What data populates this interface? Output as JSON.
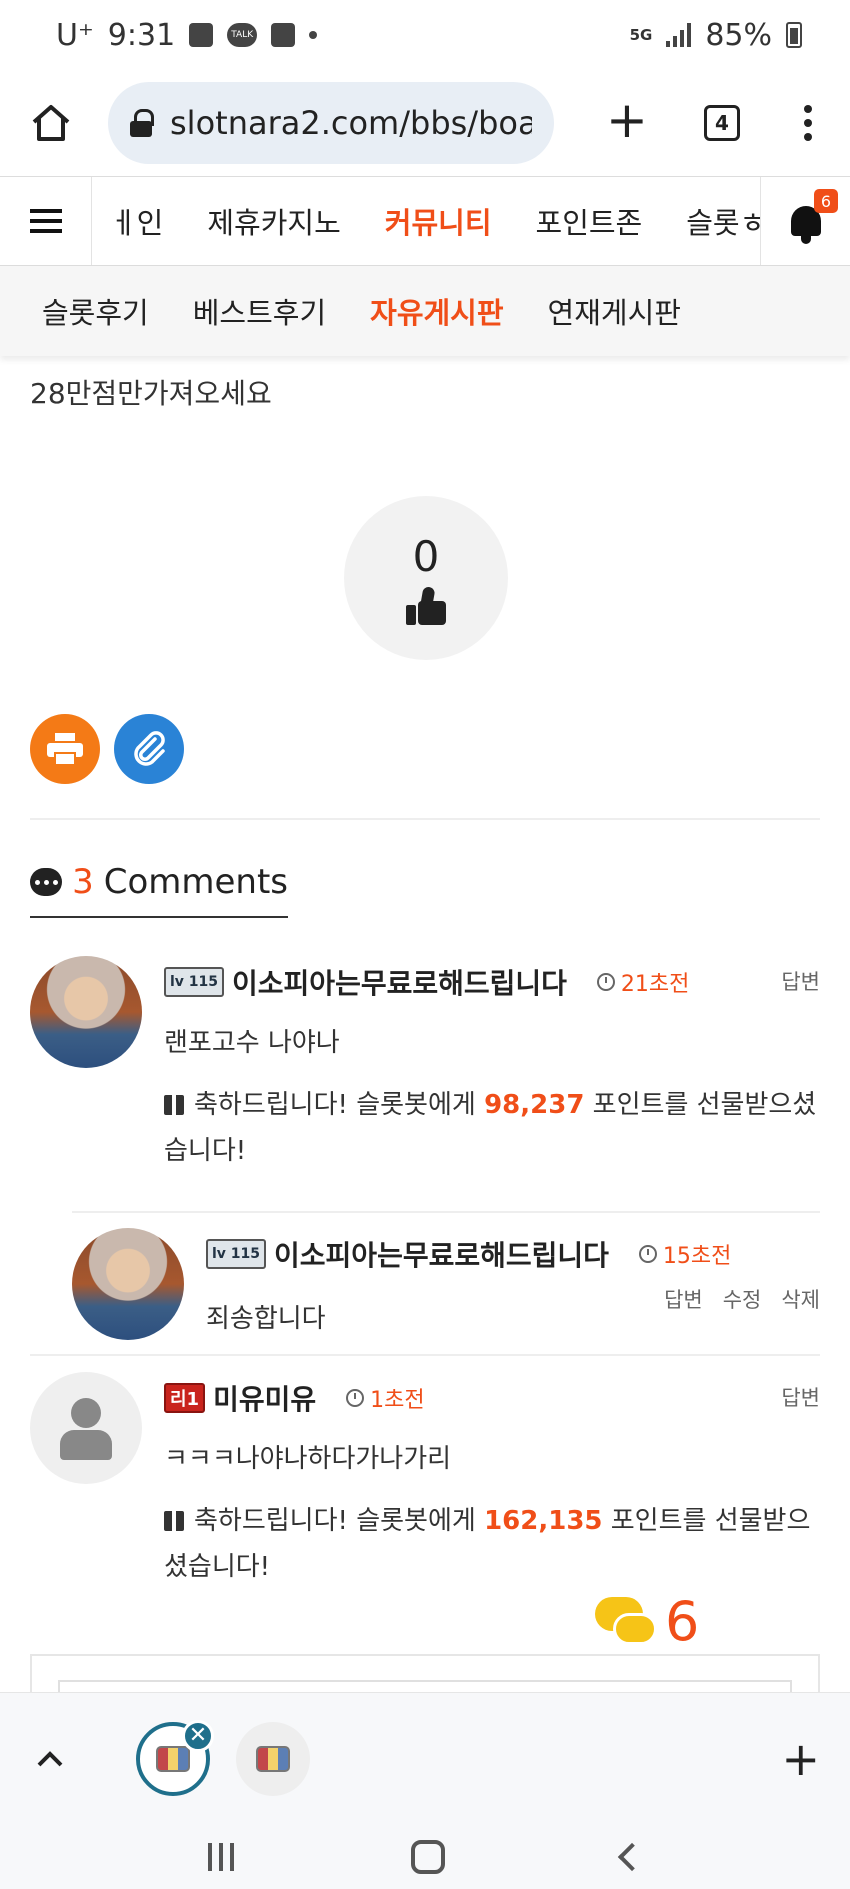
{
  "status_bar": {
    "carrier": "U⁺",
    "time": "9:31",
    "network": "5G",
    "battery": "85%"
  },
  "browser": {
    "url": "slotnara2.com/bbs/boar",
    "tab_count": "4"
  },
  "main_nav": {
    "items": [
      "ㅔ인",
      "제휴카지노",
      "커뮤니티",
      "포인트존",
      "슬롯ㅎ"
    ],
    "active_index": 2,
    "notification_count": "6"
  },
  "sub_nav": {
    "items": [
      "슬롯후기",
      "베스트후기",
      "자유게시판",
      "연재게시판"
    ],
    "active_index": 2
  },
  "post": {
    "body": "28만점만가져오세요",
    "like_count": "0"
  },
  "comments": {
    "count": "3",
    "label": "Comments",
    "list": [
      {
        "level": "lv 115",
        "name": "이소피아는무료로해드립니다",
        "time": "21초전",
        "actions": [
          "답변"
        ],
        "text": "랜포고수 나야나",
        "gift_prefix": "축하드립니다! 슬롯봇에게 ",
        "gift_points": "98,237",
        "gift_suffix": " 포인트를 선물받으셨습니다!"
      },
      {
        "level": "lv 115",
        "name": "이소피아는무료로해드립니다",
        "time": "15초전",
        "actions": [
          "답변",
          "수정",
          "삭제"
        ],
        "text": "죄송합니다"
      },
      {
        "level": "리1",
        "name": "미유미유",
        "time": "1초전",
        "actions": [
          "답변"
        ],
        "text": "ㅋㅋㅋ나야나하다가나가리",
        "gift_prefix": "축하드립니다! 슬롯봇에게 ",
        "gift_points": "162,135",
        "gift_suffix": " 포인트를 선물받으셨습니다!"
      }
    ]
  },
  "floating_chat": {
    "count": "6"
  },
  "colors": {
    "accent": "#f04e18",
    "print_button": "#f47a16",
    "link_button": "#2a83d6",
    "chat_icon": "#f6c417"
  }
}
